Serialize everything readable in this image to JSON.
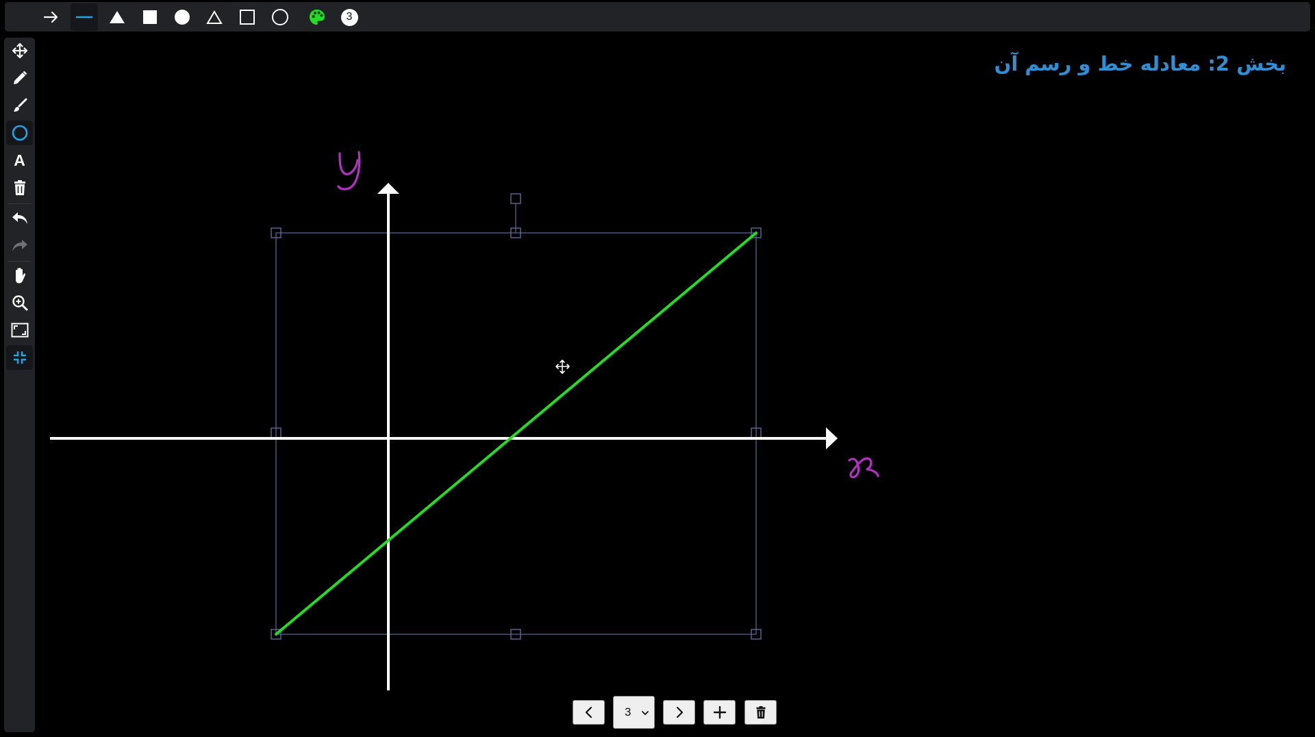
{
  "top_toolbar": {
    "tools": [
      {
        "name": "arrow-line",
        "icon": "arrow-right-icon"
      },
      {
        "name": "line",
        "icon": "line-icon",
        "active": true
      },
      {
        "name": "filled-triangle",
        "icon": "filled-triangle-icon"
      },
      {
        "name": "filled-square",
        "icon": "filled-square-icon"
      },
      {
        "name": "filled-circle",
        "icon": "filled-circle-icon"
      },
      {
        "name": "outline-triangle",
        "icon": "outline-triangle-icon"
      },
      {
        "name": "outline-square",
        "icon": "outline-square-icon"
      },
      {
        "name": "outline-circle",
        "icon": "outline-circle-icon"
      },
      {
        "name": "color-palette",
        "icon": "palette-icon",
        "color": "#22dd22"
      }
    ],
    "stroke_width_badge": "3"
  },
  "left_toolbar": {
    "tools": [
      {
        "name": "move",
        "icon": "move-icon"
      },
      {
        "name": "pencil",
        "icon": "pencil-icon"
      },
      {
        "name": "brush",
        "icon": "brush-icon"
      },
      {
        "name": "shapes",
        "icon": "circle-shape-icon",
        "active": true
      },
      {
        "name": "text",
        "icon": "text-icon",
        "glyph": "A"
      },
      {
        "name": "delete",
        "icon": "trash-icon"
      },
      {
        "name": "undo",
        "icon": "undo-icon"
      },
      {
        "name": "redo",
        "icon": "redo-icon",
        "disabled": true
      },
      {
        "name": "pan",
        "icon": "hand-icon"
      },
      {
        "name": "zoom",
        "icon": "zoom-in-icon"
      },
      {
        "name": "fit-screen",
        "icon": "fit-screen-icon"
      },
      {
        "name": "exit-fullscreen",
        "icon": "exit-fullscreen-icon",
        "active": true
      }
    ]
  },
  "heading": {
    "text": "بخش 2: معادله خط و رسم آن",
    "color": "#2e8fd6"
  },
  "canvas": {
    "background": "#000000",
    "axis_color": "#ffffff",
    "handwritten_labels": [
      {
        "text": "y",
        "color": "#b62fc4"
      },
      {
        "text": "x",
        "color": "#b62fc4"
      }
    ],
    "line_color": "#22dd22",
    "selection_color": "#5a6a9a"
  },
  "page_nav": {
    "current_page": "3",
    "prev_icon": "chevron-left-icon",
    "next_icon": "chevron-right-icon",
    "add_icon": "plus-icon",
    "delete_icon": "trash-icon"
  }
}
